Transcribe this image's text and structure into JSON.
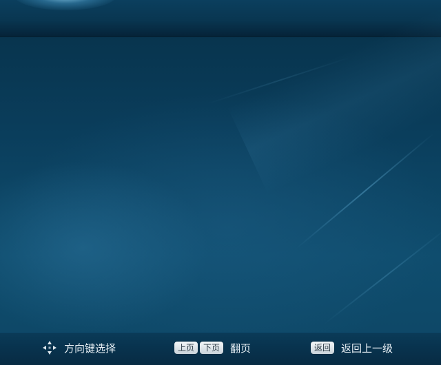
{
  "footer": {
    "select_hint": {
      "icon": "dpad-icon",
      "label": "方向键选择"
    },
    "page_hint": {
      "keys": [
        "上页",
        "下页"
      ],
      "label": "翻页"
    },
    "back_hint": {
      "key": "返回",
      "label": "返回上一级"
    }
  },
  "colors": {
    "background": "#0a3d5b",
    "bar": "#08324d",
    "text": "#e8f0f5",
    "key_face": "#dfe6ea"
  }
}
